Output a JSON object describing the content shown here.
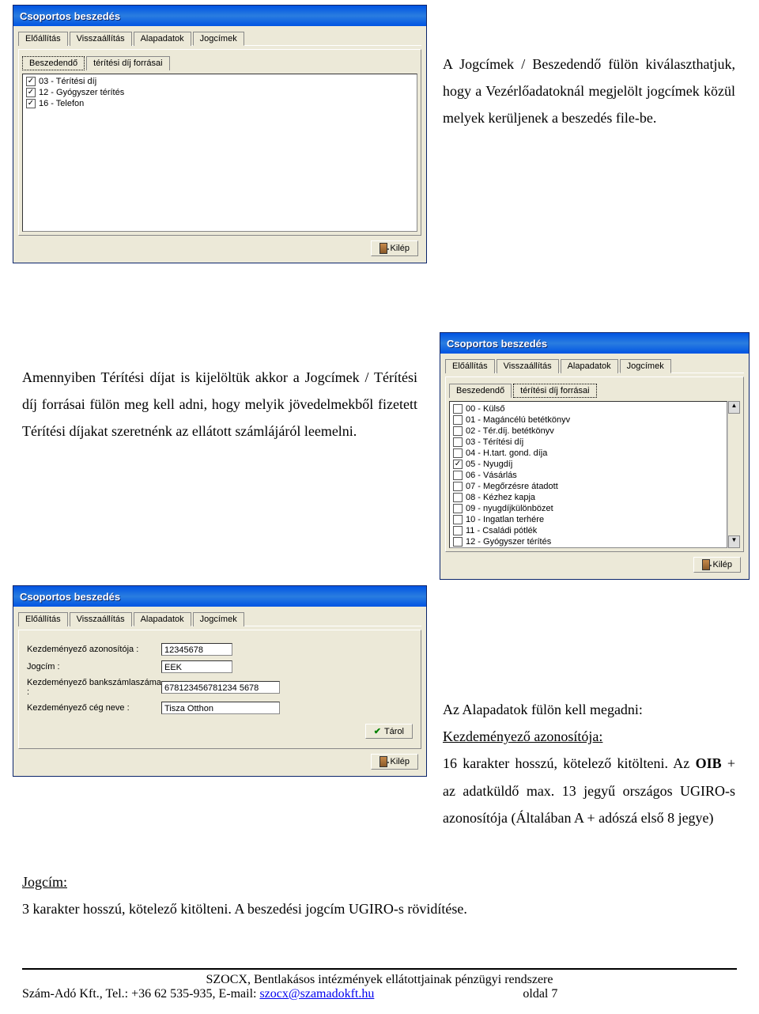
{
  "win1": {
    "title": "Csoportos beszedés",
    "tabs": [
      "Előállítás",
      "Visszaállítás",
      "Alapadatok",
      "Jogcímek"
    ],
    "activeTab": 3,
    "subtabs": [
      "Beszedendő",
      "térítési díj forrásai"
    ],
    "activeSub": 0,
    "items": [
      {
        "checked": true,
        "label": "03 - Térítési díj"
      },
      {
        "checked": true,
        "label": "12 - Gyógyszer térítés"
      },
      {
        "checked": true,
        "label": "16 - Telefon"
      }
    ],
    "exit": "Kilép"
  },
  "para1": "A Jogcímek / Beszedendő fülön kiválaszthatjuk, hogy a Vezérlőadatoknál megjelölt jogcímek közül melyek kerüljenek a beszedés file-be.",
  "para2": "Amennyiben Térítési díjat is kijelöltük akkor a Jogcímek / Térítési díj forrásai fülön meg kell adni, hogy melyik jövedelmekből fizetett Térítési díjakat szeretnénk az ellátott számlájáról leemelni.",
  "win2": {
    "title": "Csoportos beszedés",
    "tabs": [
      "Előállítás",
      "Visszaállítás",
      "Alapadatok",
      "Jogcímek"
    ],
    "activeTab": 3,
    "subtabs": [
      "Beszedendő",
      "térítési díj forrásai"
    ],
    "activeSub": 1,
    "items": [
      {
        "checked": false,
        "label": "00 - Külső"
      },
      {
        "checked": false,
        "label": "01 - Magáncélú betétkönyv"
      },
      {
        "checked": false,
        "label": "02 - Tér.díj. betétkönyv"
      },
      {
        "checked": false,
        "label": "03 - Térítési díj"
      },
      {
        "checked": false,
        "label": "04 - H.tart. gond. díja"
      },
      {
        "checked": true,
        "label": "05 - Nyugdíj"
      },
      {
        "checked": false,
        "label": "06 - Vásárlás"
      },
      {
        "checked": false,
        "label": "07 - Megőrzésre átadott"
      },
      {
        "checked": false,
        "label": "08 - Kézhez kapja"
      },
      {
        "checked": false,
        "label": "09 - nyugdíjkülönbözet"
      },
      {
        "checked": false,
        "label": "10 - Ingatlan terhére"
      },
      {
        "checked": false,
        "label": "11 - Családi pótlék"
      },
      {
        "checked": false,
        "label": "12 - Gyógyszer térítés"
      }
    ],
    "exit": "Kilép"
  },
  "win3": {
    "title": "Csoportos beszedés",
    "tabs": [
      "Előállítás",
      "Visszaállítás",
      "Alapadatok",
      "Jogcímek"
    ],
    "activeTab": 2,
    "fields": {
      "id_label": "Kezdeményező azonosítója :",
      "id_value": "12345678",
      "jog_label": "Jogcím :",
      "jog_value": "EEK",
      "bank_label": "Kezdeményező bankszámlaszáma :",
      "bank_value": "678123456781234 5678",
      "ceg_label": "Kezdeményező cég neve :",
      "ceg_value": "Tisza Otthon"
    },
    "save": "Tárol",
    "exit": "Kilép"
  },
  "para3a": "Az Alapadatok fülön kell megadni:",
  "para3b": "Kezdeményező azonosítója:",
  "para3c_pre": "16 karakter hosszú, kötelező kitölteni. Az ",
  "para3c_bold": "OIB",
  "para3c_post": " + az adatküldő max. 13 jegyű országos UGIRO-s azonosítója (Általában A + adószá első 8 jegye)",
  "para4a": "Jogcím:",
  "para4b": "3 karakter hosszú, kötelező kitölteni. A beszedési jogcím UGIRO-s rövidítése.",
  "footer": {
    "line1": "SZOCX, Bentlakásos intézmények ellátottjainak pénzügyi rendszere",
    "line2a": "Szám-Adó Kft., Tel.: +36 62 535-935, E-mail: ",
    "email": "szocx@szamadokft.hu",
    "page": "oldal 7"
  }
}
